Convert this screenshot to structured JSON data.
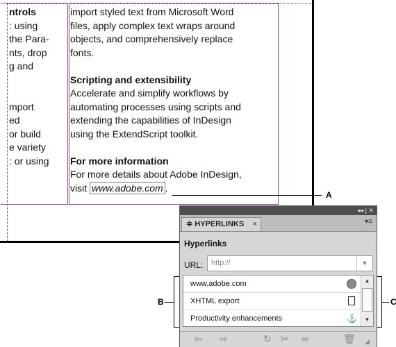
{
  "document": {
    "left_column_lines": [
      "ntrols",
      ": using",
      "the Para-",
      "nts, drop",
      "g and",
      "",
      "",
      "mport",
      "ed",
      "or build",
      "e variety",
      ": or using"
    ],
    "right_column": {
      "line1": "import styled text from Microsoft Word",
      "line2": "files, apply complex text wraps around",
      "line3": "objects, and comprehensively replace",
      "line4": "fonts.",
      "heading2": "Scripting and extensibility",
      "line6": "Accelerate and simplify workflows by",
      "line7": "automating processes using scripts and",
      "line8": "extending the capabilities of InDesign",
      "line9": "using the ExtendScript toolkit.",
      "heading3": "For more information",
      "line11": "For more details about Adobe InDesign,",
      "visit_prefix": "visit ",
      "link_text": "www.adobe.com",
      "visit_suffix": "."
    }
  },
  "callouts": {
    "a": "A",
    "b": "B",
    "c": "C"
  },
  "panel": {
    "titlebar_icons": "◂◂ | ✕",
    "tab_label": "≑ HYPERLINKS",
    "tab_close": "×",
    "menu_icon": "▾≡",
    "heading": "Hyperlinks",
    "url_label": "URL:",
    "url_value": "http://",
    "items": [
      {
        "label": "www.adobe.com",
        "icon": "globe-icon"
      },
      {
        "label": "XHTML export",
        "icon": "page-icon"
      },
      {
        "label": "Productivity enhancements",
        "icon": "anchor-icon"
      }
    ],
    "bottom_icons": [
      "go-to-source-icon",
      "go-to-destination-icon",
      "update-icon",
      "reset-icon",
      "create-link-icon",
      "delete-icon"
    ]
  },
  "colors": {
    "frame": "#9c4e9c",
    "panel_bg": "#d6d6d6",
    "titlebar": "#4e4e4e"
  }
}
